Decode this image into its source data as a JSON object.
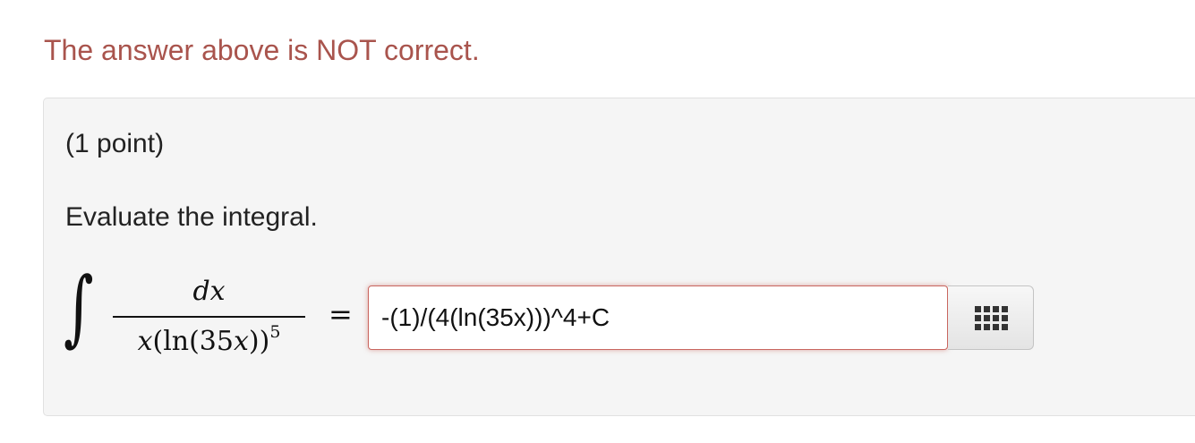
{
  "feedback": {
    "status_text": "The answer above is NOT correct.",
    "status_color": "#a9544d"
  },
  "problem": {
    "points_label": "(1 point)",
    "instruction": "Evaluate the integral.",
    "integral": {
      "sign": "∫",
      "numerator": "dx",
      "denominator_prefix": "x(ln(35",
      "denominator_var": "x",
      "denominator_suffix": "))",
      "exponent": "5",
      "equals": "="
    },
    "answer": {
      "value": "-(1)/(4(ln(35x)))^4+C",
      "border_color": "#c9665f"
    },
    "palette_button": {
      "icon": "grid-icon"
    }
  }
}
